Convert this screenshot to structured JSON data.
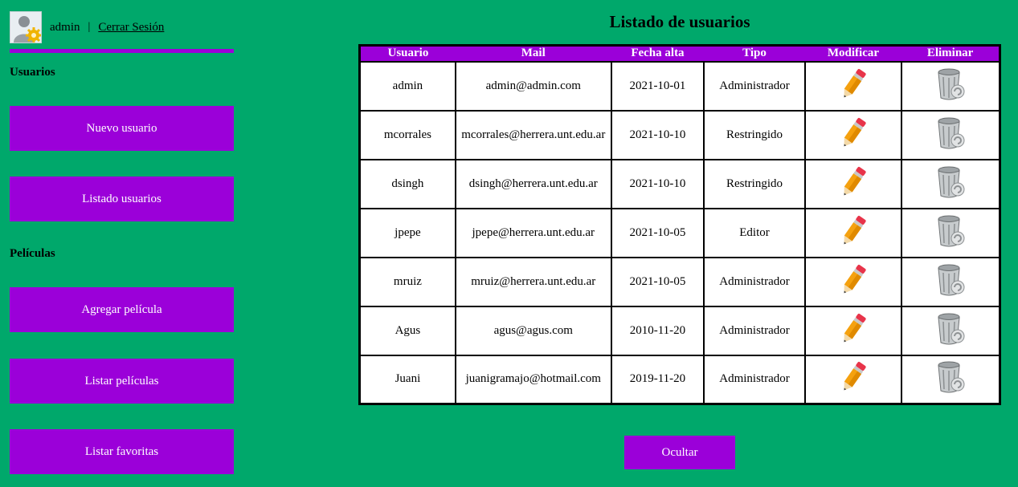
{
  "header": {
    "username": "admin",
    "separator": "|",
    "logout_label": "Cerrar Sesión"
  },
  "sidebar": {
    "section_users": "Usuarios",
    "new_user": "Nuevo usuario",
    "list_users": "Listado usuarios",
    "section_movies": "Películas",
    "add_movie": "Agregar película",
    "list_movies": "Listar películas",
    "list_favorites": "Listar favoritas"
  },
  "main": {
    "title": "Listado de usuarios",
    "columns": [
      "Usuario",
      "Mail",
      "Fecha alta",
      "Tipo",
      "Modificar",
      "Eliminar"
    ],
    "rows": [
      {
        "user": "admin",
        "mail": "admin@admin.com",
        "date": "2021-10-01",
        "type": "Administrador"
      },
      {
        "user": "mcorrales",
        "mail": "mcorrales@herrera.unt.edu.ar",
        "date": "2021-10-10",
        "type": "Restringido"
      },
      {
        "user": "dsingh",
        "mail": "dsingh@herrera.unt.edu.ar",
        "date": "2021-10-10",
        "type": "Restringido"
      },
      {
        "user": "jpepe",
        "mail": "jpepe@herrera.unt.edu.ar",
        "date": "2021-10-05",
        "type": "Editor"
      },
      {
        "user": "mruiz",
        "mail": "mruiz@herrera.unt.edu.ar",
        "date": "2021-10-05",
        "type": "Administrador"
      },
      {
        "user": "Agus",
        "mail": "agus@agus.com",
        "date": "2010-11-20",
        "type": "Administrador"
      },
      {
        "user": "Juani",
        "mail": "juanigramajo@hotmail.com",
        "date": "2019-11-20",
        "type": "Administrador"
      }
    ],
    "hide_button": "Ocultar"
  },
  "colors": {
    "background": "#00a86b",
    "accent": "#9b00d9"
  },
  "icons": {
    "avatar": "user-gear-icon",
    "edit": "pencil-icon",
    "delete": "trash-can-icon"
  }
}
